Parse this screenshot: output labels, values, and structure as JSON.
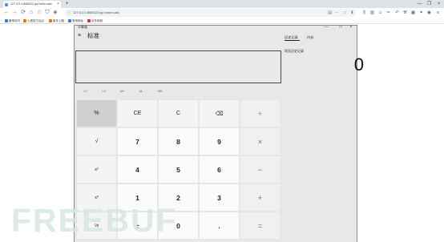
{
  "browser": {
    "tab_title": "127.0.0.1:8080/22.jsp?cmd=calc",
    "tab_close_glyph": "×",
    "newtab_glyph": "+",
    "url": "127.0.0.1:8080/22.jsp?cmd=calc",
    "window_controls": {
      "minimize": "—",
      "maximize": "❐",
      "close": "×"
    },
    "nav": {
      "back": "←",
      "forward": "→",
      "reload": "⟳",
      "home": "⌂"
    },
    "bookmarks": [
      {
        "label": "最常访问",
        "color": "#3c78d8"
      },
      {
        "label": "火狐官方站点",
        "color": "#e8710a"
      },
      {
        "label": "新手上路",
        "color": "#e8710a"
      },
      {
        "label": "常用网址",
        "color": "#3c78d8"
      },
      {
        "label": "京东商城",
        "color": "#d93025"
      }
    ]
  },
  "calculator": {
    "app_title": "计算器",
    "controls": {
      "minimize": "—",
      "maximize": "□",
      "close": "×"
    },
    "menu_glyph": "≡",
    "mode": "标准",
    "display": "0",
    "memory_buttons": [
      "MC",
      "MR",
      "M+",
      "M-",
      "MS"
    ],
    "keys": [
      [
        "%",
        "CE",
        "C",
        "⌫",
        "÷"
      ],
      [
        "√",
        "7",
        "8",
        "9",
        "×"
      ],
      [
        "x²",
        "4",
        "5",
        "6",
        "−"
      ],
      [
        "x³",
        "1",
        "2",
        "3",
        "+"
      ],
      [
        "⅟x",
        "±",
        "0",
        ".",
        "="
      ]
    ],
    "history_tabs": [
      "历史记录",
      "内存"
    ],
    "history_empty": "尚无历史记录"
  },
  "watermark": "FREEBUF"
}
